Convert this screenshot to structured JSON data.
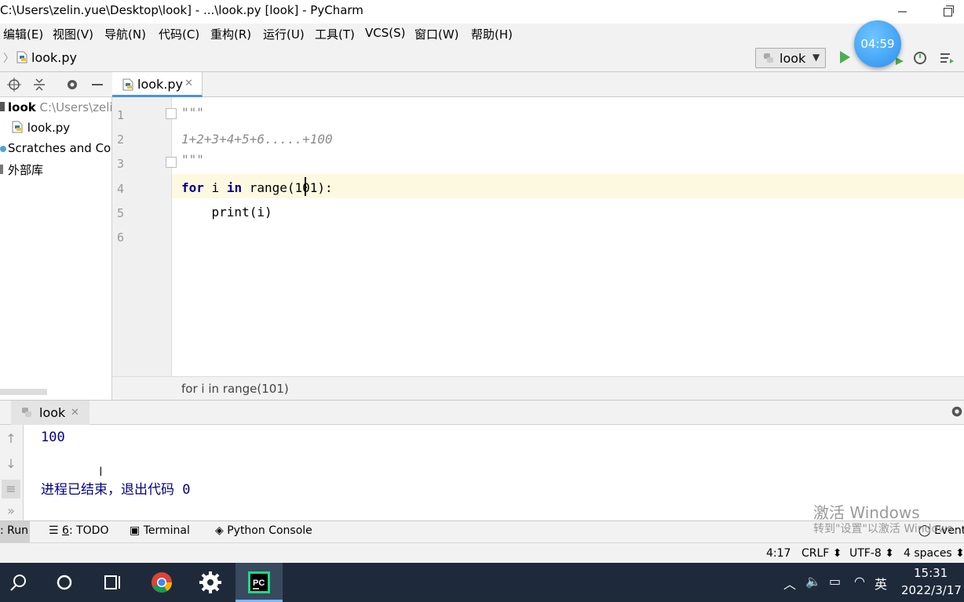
{
  "window": {
    "title": "C:\\Users\\zelin.yue\\Desktop\\look] - ...\\look.py [look] - PyCharm"
  },
  "menu": [
    "编辑(E)",
    "视图(V)",
    "导航(N)",
    "代码(C)",
    "重构(R)",
    "运行(U)",
    "工具(T)",
    "VCS(S)",
    "窗口(W)",
    "帮助(H)"
  ],
  "navbar": {
    "file": "look.py",
    "run_config": "look"
  },
  "timer": "04:59",
  "project": {
    "root_name": "look",
    "root_path": "C:\\Users\\zeli",
    "file": "look.py",
    "scratches": "Scratches and Con",
    "external_libs": "外部库"
  },
  "editor": {
    "tab": "look.py",
    "line_numbers": [
      "1",
      "2",
      "3",
      "4",
      "5",
      "6"
    ],
    "lines": {
      "l1": "\"\"\"",
      "l2": "1+2+3+4+5+6.....+100",
      "l3": "\"\"\"",
      "l4_kw1": "for",
      "l4_mid": " i ",
      "l4_kw2": "in",
      "l4_rest": " range(101):",
      "l5": "    print(i)"
    },
    "breadcrumb": "for i in range(101)"
  },
  "run_panel": {
    "tab": "look",
    "output": [
      "100",
      "进程已结束，退出代码 0"
    ]
  },
  "tool_windows": {
    "run": ": Run",
    "todo_num": "6",
    "todo": ": TODO",
    "terminal": "Terminal",
    "python_console": "Python Console",
    "event": "Event"
  },
  "status": {
    "position": "4:17",
    "line_sep": "CRLF",
    "encoding": "UTF-8",
    "indent": "4 spaces"
  },
  "watermark": {
    "line1": "激活 Windows",
    "line2": "转到\"设置\"以激活 Windows。"
  },
  "taskbar": {
    "ime": "英",
    "time": "15:31",
    "date": "2022/3/17"
  },
  "colors": {
    "accent": "#4a90e2",
    "keyword": "#000080",
    "comment": "#8c8c8c",
    "current_line": "#fdf8e0",
    "timer": "#2b8ef0"
  }
}
